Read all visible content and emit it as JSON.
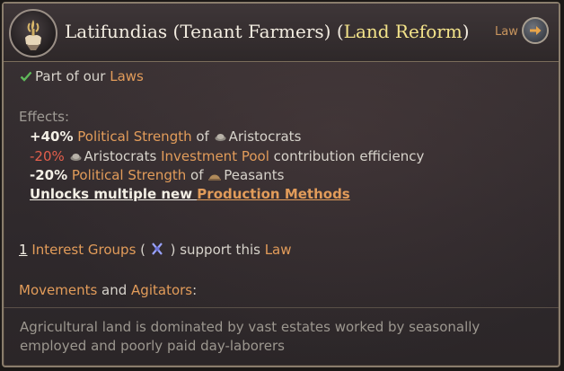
{
  "header": {
    "title_main": "Latifundias (Tenant Farmers) (",
    "title_accent": "Land Reform",
    "title_close": ")",
    "law_label": "Law",
    "emblem_icon": "hand-wheat-icon",
    "law_button_icon": "arrow-right-icon"
  },
  "status": {
    "check_icon": "checkmark-icon",
    "prefix": "Part of our ",
    "link": "Laws"
  },
  "effects": {
    "heading": "Effects:",
    "items": [
      {
        "value": "+40%",
        "link": "Political Strength",
        "mid": " of ",
        "icon": "aristocrats-icon",
        "group": "Aristocrats"
      },
      {
        "value": "-20%",
        "icon": "aristocrats-icon",
        "group": "Aristocrats",
        "link": "Investment Pool",
        "suffix": " contribution efficiency"
      },
      {
        "value": "-20%",
        "link": "Political Strength",
        "mid": " of ",
        "icon": "peasants-icon",
        "group": "Peasants"
      }
    ],
    "unlock_prefix": "Unlocks multiple new ",
    "unlock_link": "Production Methods"
  },
  "support": {
    "count": "1",
    "link": "Interest Groups",
    "open": " (",
    "icon": "rural-folk-icon",
    "close": ") support this ",
    "law_link": "Law"
  },
  "movements": {
    "link1": "Movements",
    "and": " and ",
    "link2": "Agitators",
    "colon": ":"
  },
  "description": "Agricultural land is dominated by vast estates worked by seasonally employed and poorly paid day-laborers",
  "colors": {
    "accent_yellow": "#f3e38a",
    "link_orange": "#e29c5a",
    "negative_red": "#e45f4c",
    "check_green": "#5fb85a"
  }
}
